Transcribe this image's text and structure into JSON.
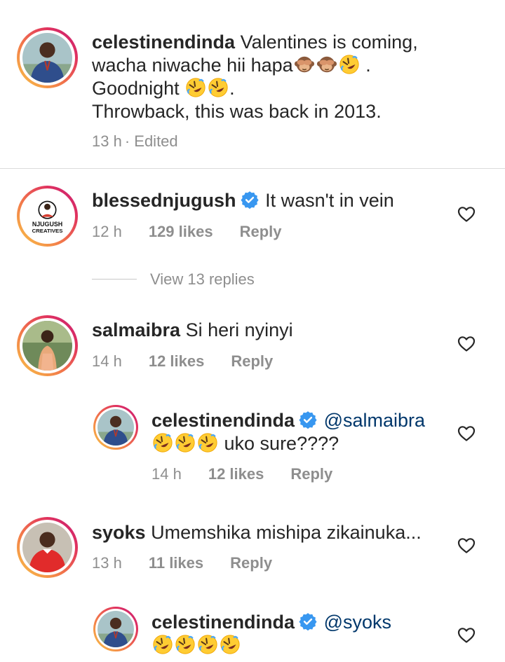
{
  "caption": {
    "username": "celestinendinda",
    "line1": "Valentines is coming,",
    "line2": "wacha niwache hii hapa",
    "line3": "Goodnight",
    "line4": "Throwback, this was back in 2013.",
    "period": ".",
    "time": "13 h",
    "edited": "· Edited"
  },
  "comments": [
    {
      "username": "blessednjugush",
      "verified": true,
      "text": "It wasn't in vein",
      "time": "12 h",
      "likes": "129 likes",
      "reply": "Reply",
      "view_replies": "View 13 replies",
      "avatar_text": "NJUGUSH CREATIVES"
    },
    {
      "username": "salmaibra",
      "verified": false,
      "text": "Si heri nyinyi",
      "time": "14 h",
      "likes": "12 likes",
      "reply": "Reply"
    },
    {
      "username": "celestinendinda",
      "verified": true,
      "is_reply": true,
      "mention": "@salmaibra",
      "text": "uko sure????",
      "time": "14 h",
      "likes": "12 likes",
      "reply": "Reply"
    },
    {
      "username": "syoks",
      "verified": false,
      "text": "Umemshika mishipa zikainuka...",
      "time": "13 h",
      "likes": "11 likes",
      "reply": "Reply"
    },
    {
      "username": "celestinendinda",
      "verified": true,
      "is_reply": true,
      "mention": "@syoks"
    }
  ],
  "icons": {
    "heart": "heart-outline-icon",
    "verified": "verified-badge-icon",
    "emoji_monkey": "see-no-evil-monkey-emoji",
    "emoji_laugh": "rolling-on-floor-laughing-emoji"
  },
  "colors": {
    "verified": "#3897f0",
    "mention": "#00376b",
    "meta": "#8e8e8e",
    "text": "#262626",
    "ring_start": "#f9c846",
    "ring_end": "#c21d7a"
  }
}
